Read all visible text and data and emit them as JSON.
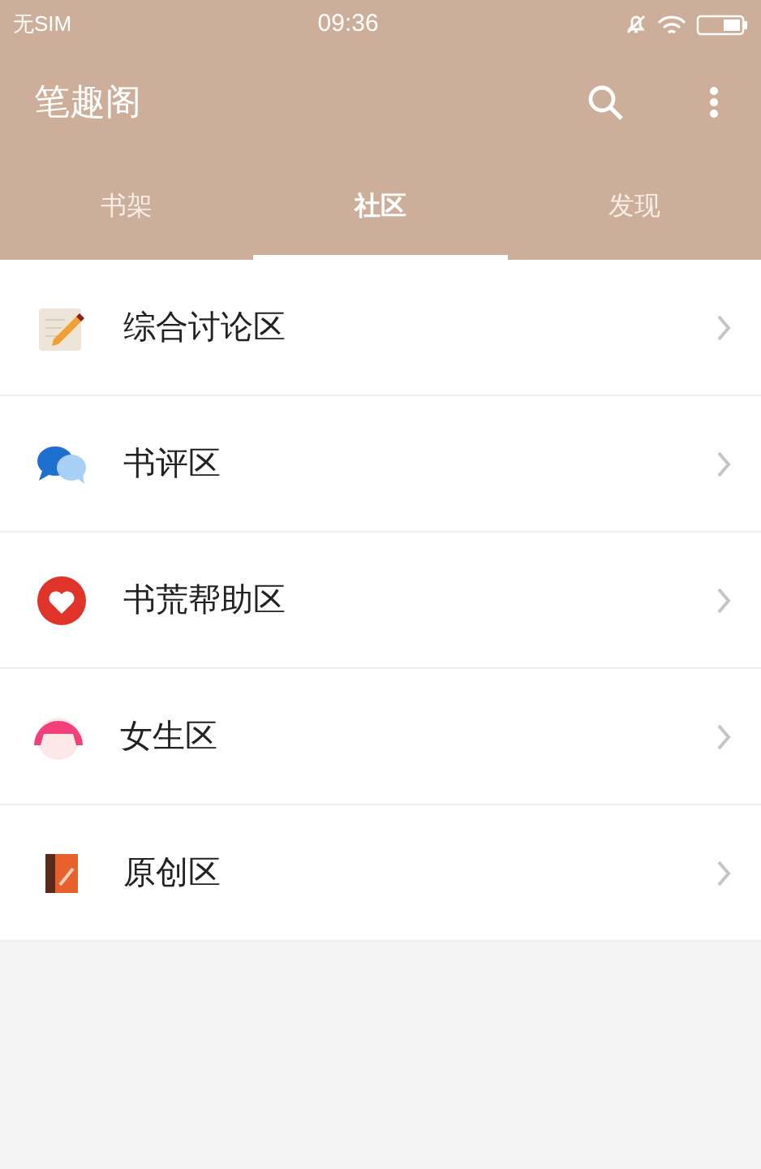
{
  "status_bar": {
    "carrier": "无SIM",
    "time": "09:36"
  },
  "app_bar": {
    "title": "笔趣阁"
  },
  "tabs": [
    {
      "label": "书架",
      "selected": false
    },
    {
      "label": "社区",
      "selected": true
    },
    {
      "label": "发现",
      "selected": false
    }
  ],
  "items": [
    {
      "label": "综合讨论区"
    },
    {
      "label": "书评区"
    },
    {
      "label": "书荒帮助区"
    },
    {
      "label": "女生区"
    },
    {
      "label": "原创区"
    }
  ]
}
